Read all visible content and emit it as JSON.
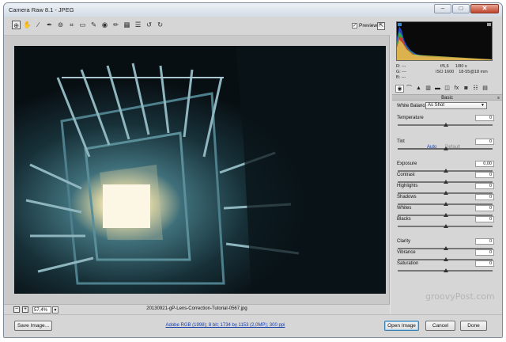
{
  "window": {
    "title": "Camera Raw 8.1  -  JPEG"
  },
  "toolbar": {
    "tools": [
      {
        "name": "zoom-tool",
        "glyph": "⊕"
      },
      {
        "name": "hand-tool",
        "glyph": "✋"
      },
      {
        "name": "white-balance-tool",
        "glyph": "⁄"
      },
      {
        "name": "color-sampler-tool",
        "glyph": "✒"
      },
      {
        "name": "targeted-adjustment-tool",
        "glyph": "⊚"
      },
      {
        "name": "crop-tool",
        "glyph": "⌗"
      },
      {
        "name": "straighten-tool",
        "glyph": "▭"
      },
      {
        "name": "spot-removal-tool",
        "glyph": "✎"
      },
      {
        "name": "red-eye-tool",
        "glyph": "◉"
      },
      {
        "name": "adjustment-brush-tool",
        "glyph": "✏"
      },
      {
        "name": "graduated-filter-tool",
        "glyph": "▦"
      },
      {
        "name": "preferences-tool",
        "glyph": "☰"
      },
      {
        "name": "rotate-left-tool",
        "glyph": "↺"
      },
      {
        "name": "rotate-right-tool",
        "glyph": "↻"
      }
    ],
    "preview_label": "Preview",
    "preview_checked": true
  },
  "histogram_readout": {
    "r": "R:   ---",
    "g": "G:   ---",
    "b": "B:   ---",
    "aperture": "f/5,6",
    "shutter": "1/80 s",
    "iso": "ISO 1600",
    "lens": "18-55@18 mm"
  },
  "panel": {
    "section_title": "Basic",
    "white_balance_label": "White Balance:",
    "white_balance_value": "As Shot",
    "auto_label": "Auto",
    "default_label": "Default",
    "sliders": [
      {
        "id": "temperature",
        "label": "Temperature",
        "value": "0",
        "level": 0.5
      },
      {
        "id": "tint",
        "label": "Tint",
        "value": "0",
        "level": 0.5
      },
      {
        "id": "exposure",
        "label": "Exposure",
        "value": "0,00",
        "level": 0.5
      },
      {
        "id": "contrast",
        "label": "Contrast",
        "value": "0",
        "level": 0.5
      },
      {
        "id": "highlights",
        "label": "Highlights",
        "value": "0",
        "level": 0.5
      },
      {
        "id": "shadows",
        "label": "Shadows",
        "value": "0",
        "level": 0.5
      },
      {
        "id": "whites",
        "label": "Whites",
        "value": "0",
        "level": 0.5
      },
      {
        "id": "blacks",
        "label": "Blacks",
        "value": "0",
        "level": 0.5
      },
      {
        "id": "clarity",
        "label": "Clarity",
        "value": "0",
        "level": 0.5
      },
      {
        "id": "vibrance",
        "label": "Vibrance",
        "value": "0",
        "level": 0.5
      },
      {
        "id": "saturation",
        "label": "Saturation",
        "value": "0",
        "level": 0.5
      }
    ]
  },
  "status": {
    "zoom_value": "57,4%",
    "filename": "20130921-gP-Lens-Correction-Tutorial-0567.jpg"
  },
  "footer": {
    "save_label": "Save Image...",
    "workflow_link": "Adobe RGB (1998); 8 bit; 1734 by 1153 (2,0MP); 300 ppi",
    "open_label": "Open Image",
    "cancel_label": "Cancel",
    "done_label": "Done"
  },
  "watermark": "groovyPost.com",
  "colors": {
    "accent_link": "#1a3fa8",
    "photo_tone": "#0d1920"
  }
}
